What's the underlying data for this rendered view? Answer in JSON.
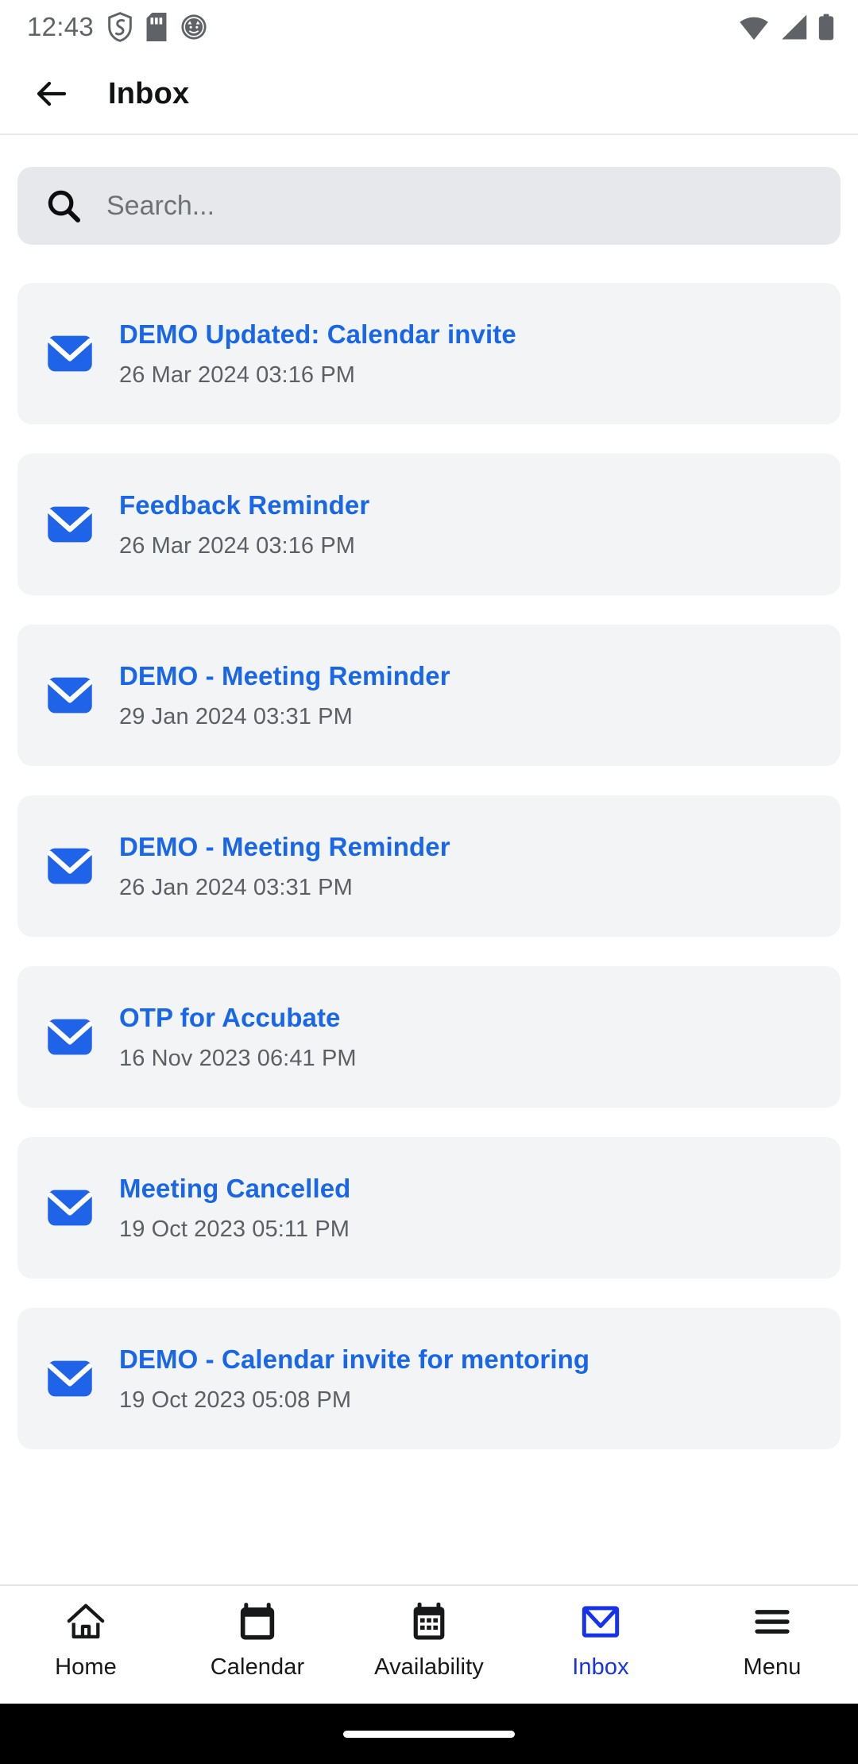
{
  "status_bar": {
    "time": "12:43",
    "left_icons": [
      "shield-icon",
      "sd-card-icon",
      "app-circle-icon"
    ],
    "right_icons": [
      "wifi-icon",
      "cell-signal-icon",
      "battery-icon"
    ]
  },
  "header": {
    "back_icon": "arrow-left-icon",
    "title": "Inbox"
  },
  "search": {
    "icon": "search-icon",
    "placeholder": "Search...",
    "value": ""
  },
  "colors": {
    "accent_blue": "#1967e8",
    "nav_active_blue": "#1633ea",
    "card_bg": "#f2f4f6",
    "search_bg": "#e6e8eb",
    "date_gray": "#5c6065",
    "title_black": "#111214"
  },
  "inbox": {
    "items": [
      {
        "icon": "envelope-icon",
        "subject": "DEMO Updated: Calendar invite",
        "date": "26 Mar 2024 03:16 PM"
      },
      {
        "icon": "envelope-icon",
        "subject": "Feedback Reminder",
        "date": "26 Mar 2024 03:16 PM"
      },
      {
        "icon": "envelope-icon",
        "subject": "DEMO - Meeting Reminder",
        "date": "29 Jan 2024 03:31 PM"
      },
      {
        "icon": "envelope-icon",
        "subject": "DEMO - Meeting Reminder",
        "date": "26 Jan 2024 03:31 PM"
      },
      {
        "icon": "envelope-icon",
        "subject": "OTP for Accubate",
        "date": "16 Nov 2023 06:41 PM"
      },
      {
        "icon": "envelope-icon",
        "subject": "Meeting Cancelled",
        "date": "19 Oct 2023 05:11 PM"
      },
      {
        "icon": "envelope-icon",
        "subject": "DEMO - Calendar invite for mentoring",
        "date": "19 Oct 2023 05:08 PM"
      }
    ]
  },
  "bottom_nav": {
    "active": "Inbox",
    "items": [
      {
        "icon": "home-icon",
        "label": "Home"
      },
      {
        "icon": "calendar-icon",
        "label": "Calendar"
      },
      {
        "icon": "calendar-grid-icon",
        "label": "Availability"
      },
      {
        "icon": "envelope-outline-icon",
        "label": "Inbox"
      },
      {
        "icon": "hamburger-menu-icon",
        "label": "Menu"
      }
    ]
  }
}
